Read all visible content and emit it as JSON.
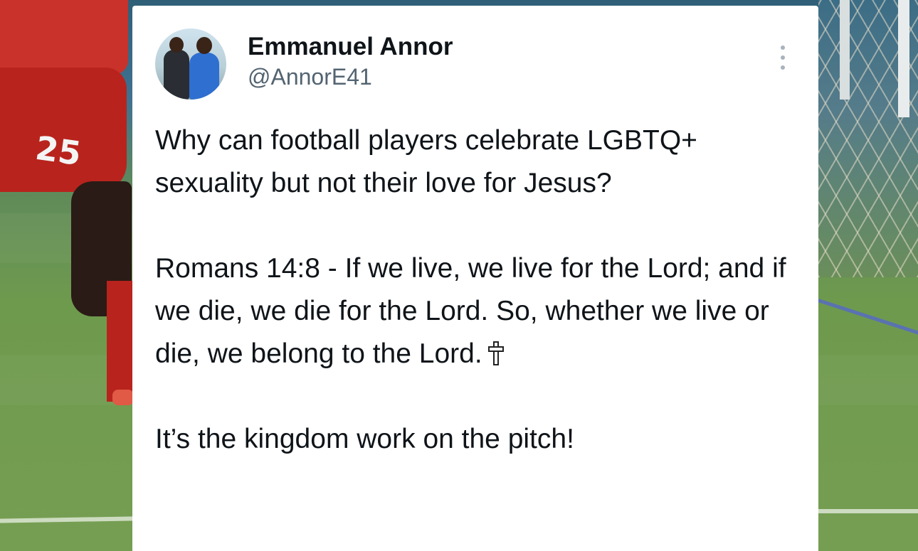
{
  "tweet": {
    "author_name": "Emmanuel Annor",
    "author_handle": "@AnnorE41",
    "paragraphs": [
      "Why can football players celebrate LGBTQ+ sexuality but not their love for Jesus?",
      "Romans 14:8 - If we live, we live for the Lord; and if we die, we die for the Lord. So, whether we live or die, we belong to the Lord.",
      "It’s the kingdom work on the pitch!"
    ],
    "emoji_icon": "latin-cross-icon",
    "more_icon": "more-options-icon"
  },
  "background": {
    "jersey_number": "25"
  },
  "colors": {
    "card": "#ffffff",
    "name_text": "#0f1419",
    "handle_text": "#536471",
    "shirt_red": "#c8322a"
  }
}
